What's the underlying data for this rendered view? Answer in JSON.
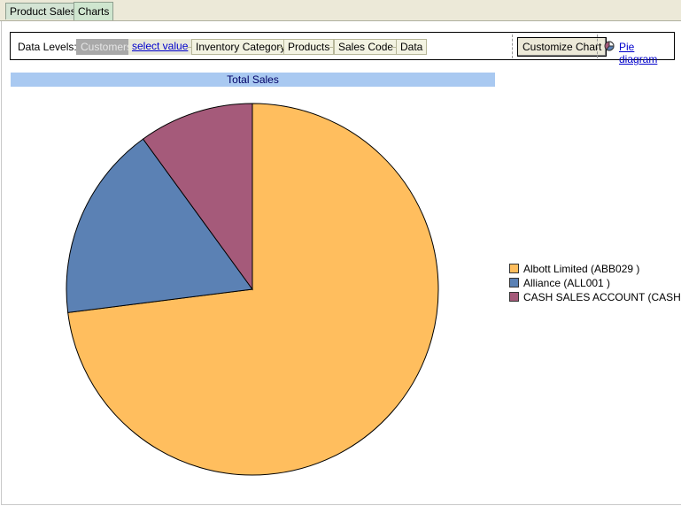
{
  "tabs": [
    {
      "label": "Product Sales",
      "active": false
    },
    {
      "label": "Charts",
      "active": true
    }
  ],
  "toolbar": {
    "data_levels_label": "Data Levels:",
    "current_level": "Customers",
    "select_value": "select value",
    "levels": [
      "Inventory Category",
      "Products",
      "Sales Code",
      "Data"
    ],
    "customize_chart": "Customize Chart",
    "pie_diagram": "Pie diagram"
  },
  "chart_data": {
    "type": "pie",
    "title": "Total Sales",
    "slices": [
      {
        "name": "Albott Limited (ABB029 )",
        "value": 73,
        "color": "#ffbe5e"
      },
      {
        "name": "Alliance (ALL001 )",
        "value": 17,
        "color": "#5b81b4"
      },
      {
        "name": "CASH SALES ACCOUNT (CASH    )",
        "value": 10,
        "color": "#a55a7a"
      }
    ],
    "legend_position": "right"
  }
}
